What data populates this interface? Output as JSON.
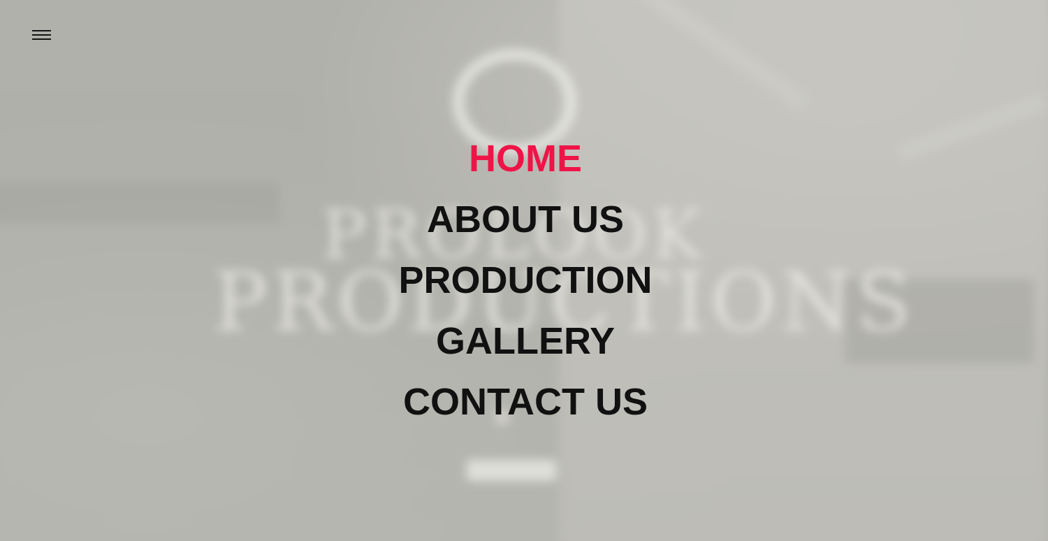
{
  "background": {
    "brand_line_1": "PROLOOK",
    "brand_line_2": "PRODUCTIONS"
  },
  "menu_toggle": {
    "icon": "hamburger-icon"
  },
  "nav": {
    "items": [
      {
        "label": "HOME",
        "active": true
      },
      {
        "label": "ABOUT US",
        "active": false
      },
      {
        "label": "PRODUCTION",
        "active": false
      },
      {
        "label": "GALLERY",
        "active": false
      },
      {
        "label": "CONTACT US",
        "active": false
      }
    ]
  },
  "colors": {
    "active": "#ef1447",
    "text": "#111111",
    "overlay": "#b3b3ad"
  }
}
